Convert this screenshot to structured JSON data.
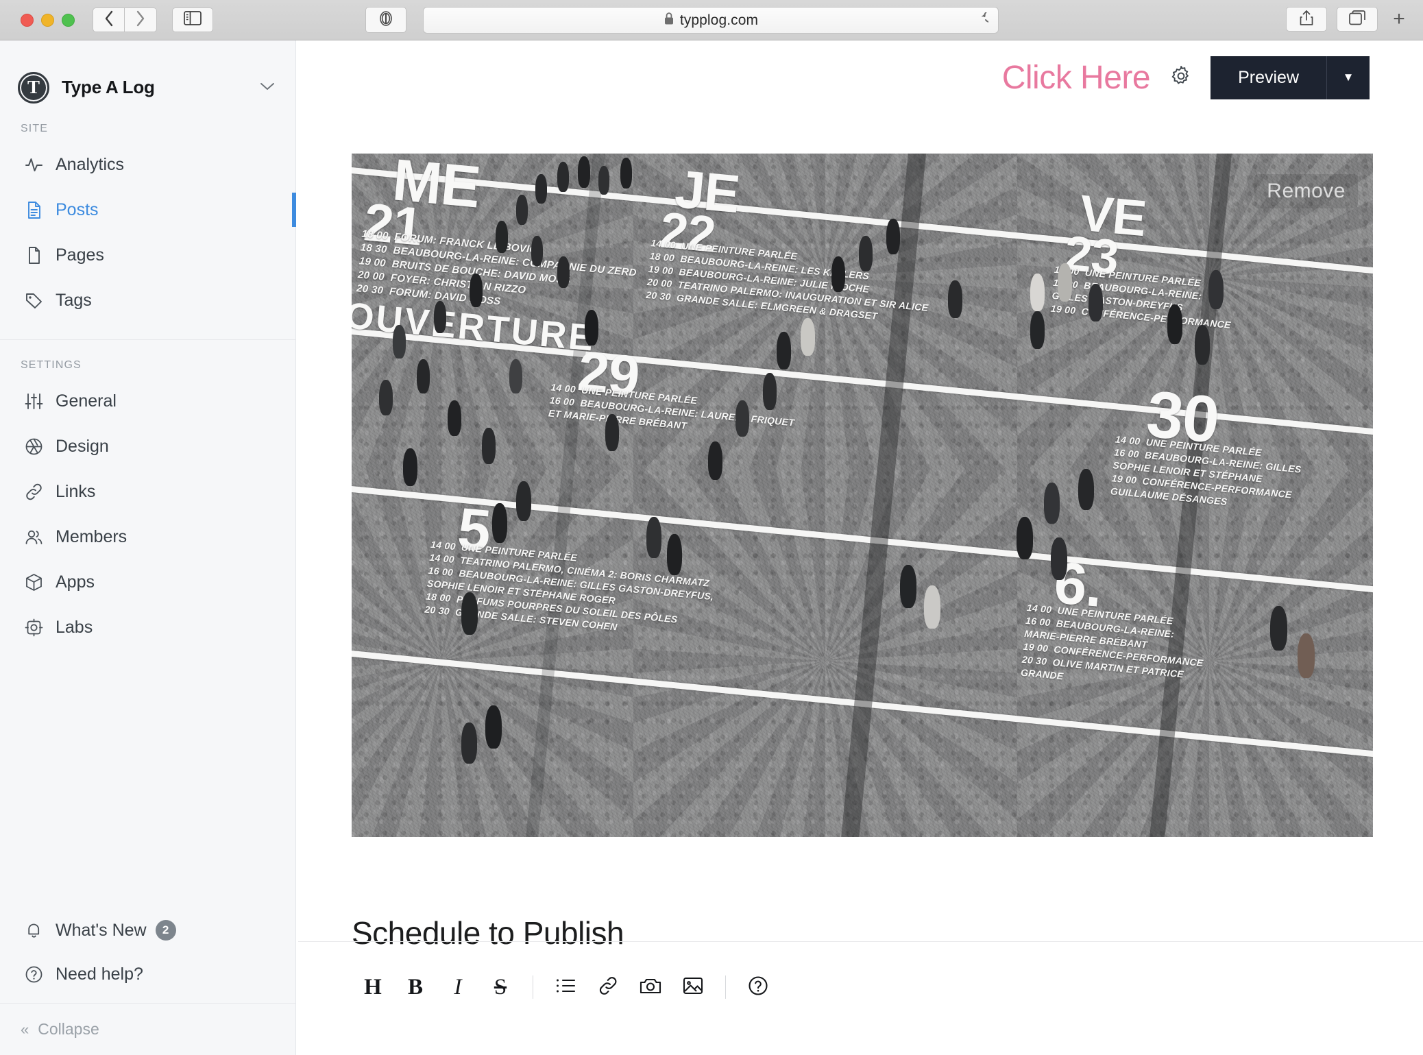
{
  "browser": {
    "url": "typplog.com",
    "lock_icon": "lock-icon",
    "back_icon": "chevron-left-icon",
    "forward_icon": "chevron-right-icon",
    "sidebar_toggle_icon": "sidebar-toggle-icon",
    "reader_icon": "reader-mode-icon",
    "reload_icon": "reload-icon",
    "share_icon": "share-icon",
    "tabs_icon": "new-tab-overview-icon",
    "new_tab_label": "+"
  },
  "sidebar": {
    "site_name": "Type A Log",
    "logo_letter": "T",
    "expand_icon": "chevron-down-icon",
    "sections": [
      {
        "label": "SITE",
        "items": [
          {
            "label": "Analytics",
            "icon": "activity-icon",
            "active": false
          },
          {
            "label": "Posts",
            "icon": "document-text-icon",
            "active": true
          },
          {
            "label": "Pages",
            "icon": "document-icon",
            "active": false
          },
          {
            "label": "Tags",
            "icon": "tag-icon",
            "active": false
          }
        ]
      },
      {
        "label": "SETTINGS",
        "items": [
          {
            "label": "General",
            "icon": "sliders-icon",
            "active": false
          },
          {
            "label": "Design",
            "icon": "aperture-icon",
            "active": false
          },
          {
            "label": "Links",
            "icon": "link-icon",
            "active": false
          },
          {
            "label": "Members",
            "icon": "users-icon",
            "active": false
          },
          {
            "label": "Apps",
            "icon": "box-icon",
            "active": false
          },
          {
            "label": "Labs",
            "icon": "beaker-gear-icon",
            "active": false
          }
        ]
      }
    ],
    "bottom": {
      "whats_new_label": "What's New",
      "whats_new_badge": "2",
      "whats_new_icon": "bell-icon",
      "need_help_label": "Need help?",
      "need_help_icon": "question-circle-icon",
      "collapse_label": "Collapse",
      "collapse_icon": "double-chevron-left-icon"
    }
  },
  "header": {
    "click_here_label": "Click Here",
    "click_here_color": "#e8799f",
    "settings_icon": "gear-icon",
    "preview_label": "Preview",
    "preview_caret_icon": "caret-down-icon",
    "preview_bg": "#1d2330"
  },
  "feature_image": {
    "remove_label": "Remove",
    "alt": "Aerial view of a cobblestone plaza with crowds walking over large white painted schedule text",
    "painted_text": [
      "ME",
      "21",
      "OUVERTURE",
      "18 00   FORUM: FRANCK LEIBOVICI",
      "18 30   BEAUBOURG-LA-REINE: COMPAGNIE DU ZERD",
      "19 00   BRUITS DE BOUCHE: DAVID MOSS",
      "20 00   FOYER: CHRISTIAN RIZZO",
      "20 30   FORUM: DAVID MOSS",
      "JE",
      "22",
      "14 00   UNE PEINTURE PARLÉE",
      "18 00   BEAUBOURG-LA-REINE: LES KELLERS",
      "19 00   BEAUBOURG-LA-REINE: JULIE NIOCHE",
      "20 00   TEATRINO PALERMO: INAUGURATION ET SIR ALICE",
      "20 30   GRANDE SALLE: ELMGREEN & DRAGSET",
      "VE",
      "23",
      "14 00   UNE PEINTURE PARLÉE",
      "16 00   BEAUBOURG-LA-REINE:",
      "GILLES GASTON-DREYFUS",
      "19 00   CONFÉRENCE-PERFORMANCE",
      "29",
      "14 00   UNE PEINTURE PARLÉE",
      "16 00   BEAUBOURG-LA-REINE: LAURENT FRIQUET",
      "ET MARIE-PIERRE BRÉBANT",
      "30",
      "14 00   UNE PEINTURE PARLÉE",
      "16 00   BEAUBOURG-LA-REINE: GILLES",
      "SOPHIE LENOIR ET STÉPHANE",
      "19 00   CONFÉRENCE-PERFORMANCE",
      "GUILLAUME DÉSANGES",
      "5",
      "14 00   UNE PEINTURE PARLÉE",
      "14 00   TEATRINO PALERMO, CINÉMA 2: BORIS CHARMATZ",
      "16 00   BEAUBOURG-LA-REINE: GILLES GASTON-DREYFUS,",
      "SOPHIE LENOIR ET STÉPHANE ROGER",
      "18 00   PARFUMS POURPRES DU SOLEIL DES PÔLES",
      "20 30   GRANDE SALLE: STEVEN COHEN",
      "6",
      "14 00   UNE PEINTURE PARLÉE",
      "16 00   BEAUBOURG-LA-REINE:",
      "MARIE-PIERRE BRÉBANT",
      "19 00   CONFÉRENCE-PERFORMANCE",
      "20 30   OLIVE MARTIN ET PATRICE",
      "GRANDE"
    ]
  },
  "post": {
    "title": "Schedule to Publish"
  },
  "editor_toolbar": {
    "buttons": [
      {
        "label": "H",
        "name": "heading-button",
        "kind": "text"
      },
      {
        "label": "B",
        "name": "bold-button",
        "kind": "text"
      },
      {
        "label": "I",
        "name": "italic-button",
        "kind": "text"
      },
      {
        "label": "S",
        "name": "strikethrough-button",
        "kind": "text"
      },
      {
        "label": "",
        "name": "separator",
        "kind": "sep"
      },
      {
        "label": "",
        "name": "bullet-list-icon",
        "kind": "icon"
      },
      {
        "label": "",
        "name": "link-icon",
        "kind": "icon"
      },
      {
        "label": "",
        "name": "camera-icon",
        "kind": "icon"
      },
      {
        "label": "",
        "name": "image-icon",
        "kind": "icon"
      },
      {
        "label": "",
        "name": "separator",
        "kind": "sep"
      },
      {
        "label": "",
        "name": "help-icon",
        "kind": "icon"
      }
    ]
  }
}
